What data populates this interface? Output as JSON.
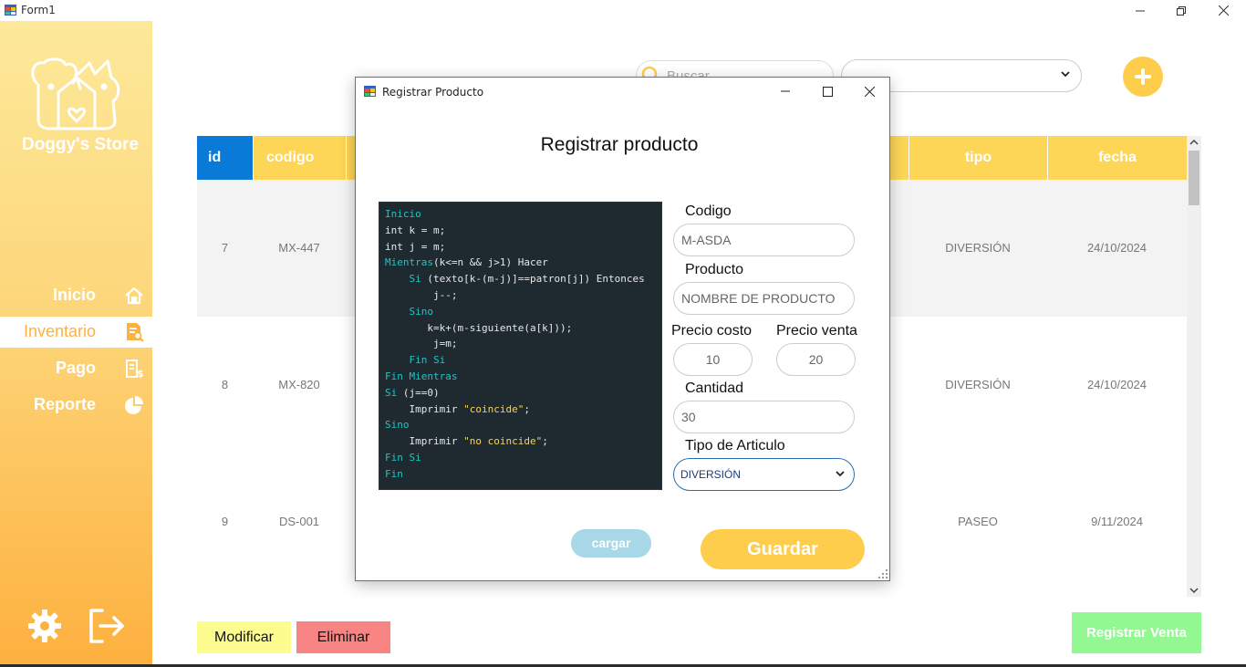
{
  "window": {
    "title": "Form1"
  },
  "sidebar": {
    "brand": "Doggy's Store",
    "items": [
      {
        "label": "Inicio",
        "icon": "home-icon"
      },
      {
        "label": "Inventario",
        "icon": "document-search-icon"
      },
      {
        "label": "Pago",
        "icon": "receipt-icon"
      },
      {
        "label": "Reporte",
        "icon": "pie-chart-icon"
      }
    ],
    "active_item": "Inventario"
  },
  "toolbar": {
    "search_placeholder": "Buscar",
    "filter_value": "",
    "add_icon": "plus-icon"
  },
  "table": {
    "columns": [
      "id",
      "codigo",
      "",
      "tipo",
      "fecha"
    ],
    "rows": [
      {
        "id": "7",
        "codigo": "MX-447",
        "tipo": "DIVERSIÓN",
        "fecha": "24/10/2024"
      },
      {
        "id": "8",
        "codigo": "MX-820",
        "tipo": "DIVERSIÓN",
        "fecha": "24/10/2024"
      },
      {
        "id": "9",
        "codigo": "DS-001",
        "tipo": "PASEO",
        "fecha": "9/11/2024"
      }
    ]
  },
  "actions": {
    "modify_label": "Modificar",
    "delete_label": "Eliminar",
    "sale_label": "Registrar Venta"
  },
  "dialog": {
    "title": "Registrar Producto",
    "heading": "Registrar producto",
    "labels": {
      "codigo": "Codigo",
      "producto": "Producto",
      "precio_costo": "Precio costo",
      "precio_venta": "Precio venta",
      "cantidad": "Cantidad",
      "tipo": "Tipo de Articulo"
    },
    "values": {
      "codigo": "M-ASDA",
      "producto": "NOMBRE DE PRODUCTO",
      "precio_costo": "10",
      "precio_venta": "20",
      "cantidad": "30",
      "tipo": "DIVERSIÓN"
    },
    "load_label": "cargar",
    "save_label": "Guardar",
    "code_image": [
      "Inicio",
      "int k = m;",
      "int j = m;",
      "Mientras(k<=n && j>1) Hacer",
      "    Si (texto[k-(m-j)]==patron[j]) Entonces",
      "        j--;",
      "    Sino",
      "       k=k+(m-siguiente(a[k]));",
      "        j=m;",
      "    Fin Si",
      "Fin Mientras",
      "Si (j==0)",
      "    Imprimir \"coincide\";",
      "Sino",
      "    Imprimir \"no coincide\";",
      "Fin Si",
      "Fin"
    ]
  },
  "colors": {
    "accent": "#fdcd4b",
    "id_header": "#0a7ad8",
    "modify": "#fdfd8f",
    "delete": "#f88484",
    "sale": "#92f892"
  }
}
